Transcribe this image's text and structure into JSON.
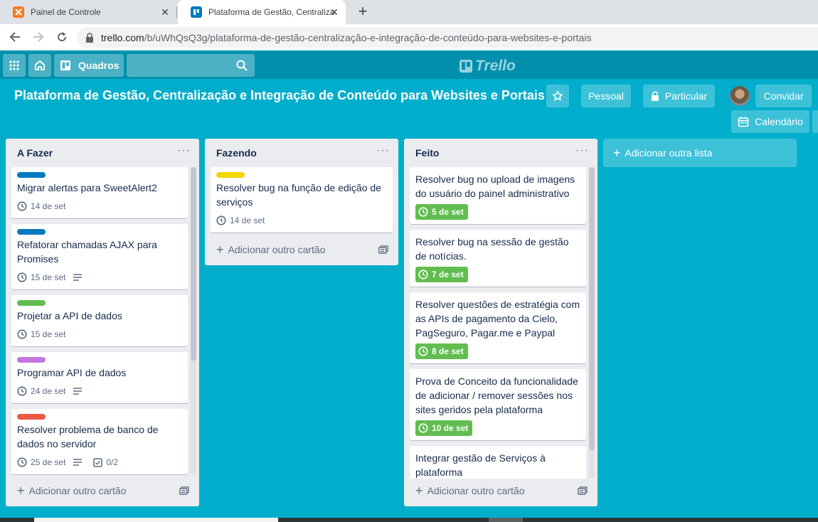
{
  "browser": {
    "tabs": [
      {
        "title": "Painel de Controle",
        "close": "✕",
        "favicon": "xampp-icon",
        "favicon_color": "#fb7a24"
      },
      {
        "title": "Plataforma de Gestão, Centraliza",
        "close": "✕",
        "favicon": "trello-icon",
        "favicon_color": "#0079bf"
      }
    ],
    "new_tab": "+",
    "url_host": "trello.com",
    "url_path": "/b/uWhQsQ3g/plataforma-de-gestão-centralização-e-integração-de-conteúdo-para-websites-e-portais"
  },
  "header": {
    "boards_label": "Quadros",
    "logo_text": "Trello"
  },
  "board": {
    "title": "Plataforma de Gestão, Centralização e Integração de Conteúdo para Websites e Portais",
    "team_label": "Pessoal",
    "visibility_label": "Particular",
    "invite_label": "Convidar",
    "calendar_label": "Calendário"
  },
  "lists": [
    {
      "title": "A Fazer",
      "menu": "···",
      "add_card": "Adicionar outro cartão",
      "cards": [
        {
          "label_color": "#0079bf",
          "title": "Migrar alertas para SweetAlert2",
          "due": "14 de set"
        },
        {
          "label_color": "#0079bf",
          "title": "Refatorar chamadas AJAX para Promises",
          "due": "15 de set",
          "has_description": true
        },
        {
          "label_color": "#61bd4f",
          "title": "Projetar a API de dados",
          "due": "15 de set"
        },
        {
          "label_color": "#c377e0",
          "title": "Programar API de dados",
          "due": "24 de set",
          "has_description": true
        },
        {
          "label_color": "#eb5a46",
          "title": "Resolver problema de banco de dados no servidor",
          "due": "25 de set",
          "has_description": true,
          "checklist": "0/2"
        }
      ]
    },
    {
      "title": "Fazendo",
      "menu": "···",
      "add_card": "Adicionar outro cartão",
      "cards": [
        {
          "label_color": "#f2d600",
          "title": "Resolver bug na função de edição de serviços",
          "due": "14 de set"
        }
      ]
    },
    {
      "title": "Feito",
      "menu": "···",
      "add_card": "Adicionar outro cartão",
      "cards": [
        {
          "title": "Resolver bug no upload de imagens do usuário do painel administrativo",
          "due": "5 de set",
          "due_complete": true
        },
        {
          "title": "Resolver bug na sessão de gestão de notícias.",
          "due": "7 de set",
          "due_complete": true
        },
        {
          "title": "Resolver questões de estratégia com as APIs de pagamento da Cielo, PagSeguro, Pagar.me e Paypal",
          "due": "8 de set",
          "due_complete": true
        },
        {
          "title": "Prova de Conceito da funcionalidade de adicionar / remover sessões nos sites geridos pela plataforma",
          "due": "10 de set",
          "due_complete": true
        },
        {
          "title": "Integrar gestão de Serviços à plataforma"
        }
      ]
    }
  ],
  "add_list_label": "Adicionar outra lista",
  "colors": {
    "board_bg": "#00aecc",
    "header_bg": "#0090ad",
    "list_bg": "#ebecf0",
    "due_complete": "#61bd4f"
  }
}
